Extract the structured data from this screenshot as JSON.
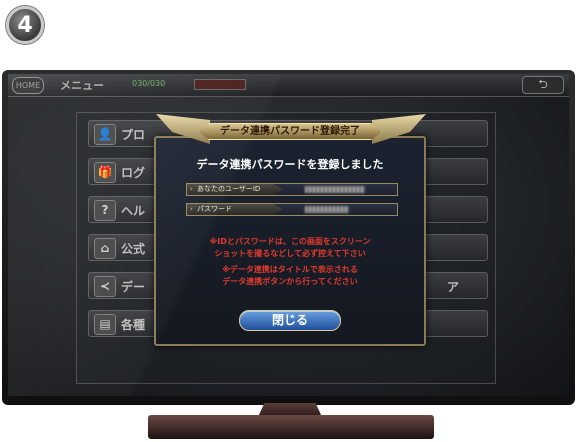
{
  "step_number": "4",
  "game": {
    "topbar": {
      "home_label": "HOME",
      "menu_title": "メニュー",
      "stamina_text": "030/030",
      "back_icon": "back-arrow-icon"
    },
    "menu_items": [
      {
        "icon": "person-icon",
        "glyph": "👤",
        "label": "プロ"
      },
      {
        "icon": "gift-icon",
        "glyph": "🎁",
        "label": "ログ"
      },
      {
        "icon": "help-icon",
        "glyph": "?",
        "label": "ヘル"
      },
      {
        "icon": "home-icon",
        "glyph": "⌂",
        "label": "公式"
      },
      {
        "icon": "share-icon",
        "glyph": "≺",
        "label": "デー",
        "label_right": "ア"
      },
      {
        "icon": "document-icon",
        "glyph": "▤",
        "label": "各種"
      }
    ],
    "dialog": {
      "title": "データ連携パスワード登録完了",
      "heading": "データ連携パスワードを登録しました",
      "user_id_label": "あなたのユーザーID",
      "password_label": "パスワード",
      "notice_1_line_1": "※IDとパスワードは、この画面をスクリーン",
      "notice_1_line_2": "ショットを撮るなどして必ず控えて下さい",
      "notice_2_line_1": "※データ連携はタイトルで表示される",
      "notice_2_line_2": "データ連携ボタンから行ってください",
      "close_label": "閉じる"
    }
  },
  "colors": {
    "notice_red": "#e43a2e",
    "gold_frame": "#8a7a55",
    "button_blue": "#2f6bbd"
  }
}
